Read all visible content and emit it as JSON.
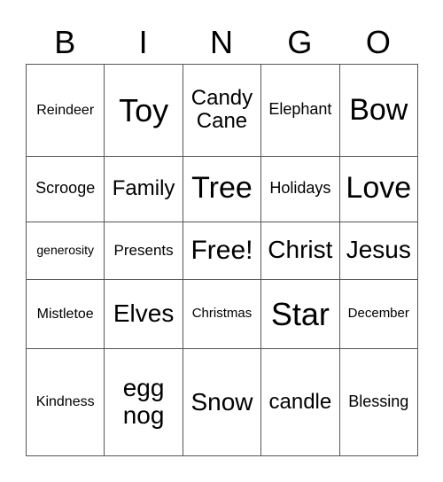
{
  "header": [
    "B",
    "I",
    "N",
    "G",
    "O"
  ],
  "cells": [
    [
      {
        "text": "Reindeer",
        "size": 16
      },
      {
        "text": "Toy",
        "size": 36
      },
      {
        "text": "Candy Cane",
        "size": 24
      },
      {
        "text": "Elephant",
        "size": 18
      },
      {
        "text": "Bow",
        "size": 34
      }
    ],
    [
      {
        "text": "Scrooge",
        "size": 18
      },
      {
        "text": "Family",
        "size": 24
      },
      {
        "text": "Tree",
        "size": 34
      },
      {
        "text": "Holidays",
        "size": 18
      },
      {
        "text": "Love",
        "size": 34
      }
    ],
    [
      {
        "text": "generosity",
        "size": 14
      },
      {
        "text": "Presents",
        "size": 17
      },
      {
        "text": "Free!",
        "size": 30
      },
      {
        "text": "Christ",
        "size": 28
      },
      {
        "text": "Jesus",
        "size": 28
      }
    ],
    [
      {
        "text": "Mistletoe",
        "size": 16
      },
      {
        "text": "Elves",
        "size": 28
      },
      {
        "text": "Christmas",
        "size": 15
      },
      {
        "text": "Star",
        "size": 36
      },
      {
        "text": "December",
        "size": 15
      }
    ],
    [
      {
        "text": "Kindness",
        "size": 16
      },
      {
        "text": "egg nog",
        "size": 28
      },
      {
        "text": "Snow",
        "size": 28
      },
      {
        "text": "candle",
        "size": 24
      },
      {
        "text": "Blessing",
        "size": 18
      }
    ]
  ]
}
